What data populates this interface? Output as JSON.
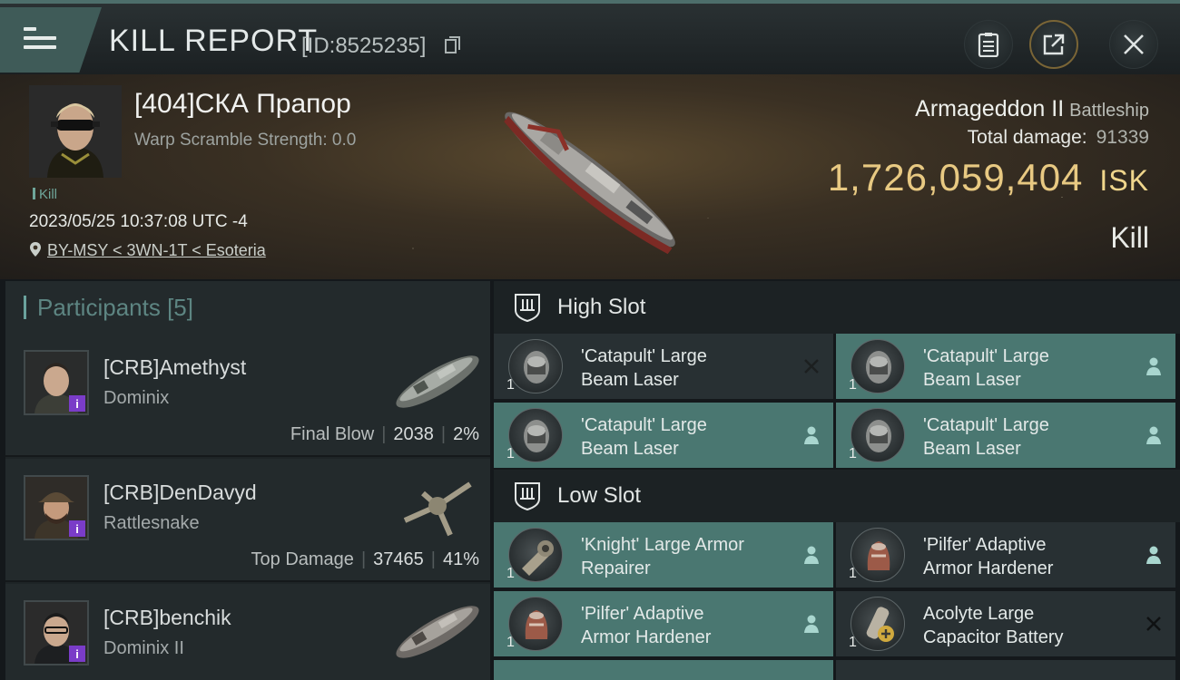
{
  "header": {
    "title": "KILL REPORT",
    "report_id": "[ID:8525235]",
    "icons": [
      "menu-icon",
      "copy-icon",
      "clipboard-icon",
      "share-icon",
      "close-icon"
    ]
  },
  "victim": {
    "name": "[404]СКА Прапор",
    "warp_scramble": "Warp Scramble Strength: 0.0",
    "kill_tag": "Kill",
    "datetime": "2023/05/25 10:37:08 UTC -4",
    "location": "BY-MSY < 3WN-1T < Esoteria",
    "ship_name": "Armageddon II",
    "ship_class": "Battleship",
    "total_damage_label": "Total damage:",
    "total_damage": "91339",
    "isk_value": "1,726,059,404",
    "isk_unit": "ISK",
    "result": "Kill"
  },
  "participants": {
    "label": "Participants",
    "count": "[5]",
    "items": [
      {
        "name": "[CRB]Amethyst",
        "ship": "Dominix",
        "role": "Final Blow",
        "damage": "2038",
        "percent": "2%"
      },
      {
        "name": "[CRB]DenDavyd",
        "ship": "Rattlesnake",
        "role": "Top Damage",
        "damage": "37465",
        "percent": "41%"
      },
      {
        "name": "[CRB]benchik",
        "ship": "Dominix II",
        "role": "",
        "damage": "",
        "percent": ""
      }
    ]
  },
  "slots": {
    "high": {
      "label": "High Slot",
      "items": [
        {
          "line1": "'Catapult' Large",
          "line2": "Beam Laser",
          "qty": "1",
          "status": "destroyed"
        },
        {
          "line1": "'Catapult' Large",
          "line2": "Beam Laser",
          "qty": "1",
          "status": "dropped"
        },
        {
          "line1": "'Catapult' Large",
          "line2": "Beam Laser",
          "qty": "1",
          "status": "dropped"
        },
        {
          "line1": "'Catapult' Large",
          "line2": "Beam Laser",
          "qty": "1",
          "status": "dropped"
        }
      ]
    },
    "low": {
      "label": "Low Slot",
      "items": [
        {
          "line1": "'Knight' Large Armor",
          "line2": "Repairer",
          "qty": "1",
          "status": "dropped"
        },
        {
          "line1": "'Pilfer' Adaptive",
          "line2": "Armor Hardener",
          "qty": "1",
          "status": "dropped"
        },
        {
          "line1": "'Pilfer' Adaptive",
          "line2": "Armor Hardener",
          "qty": "1",
          "status": "dropped"
        },
        {
          "line1": "Acolyte Large",
          "line2": "Capacitor Battery",
          "qty": "1",
          "status": "destroyed"
        }
      ]
    }
  },
  "colors": {
    "accent": "#4a7771",
    "isk": "#e8c982",
    "destroyed_bg": "#283033"
  }
}
